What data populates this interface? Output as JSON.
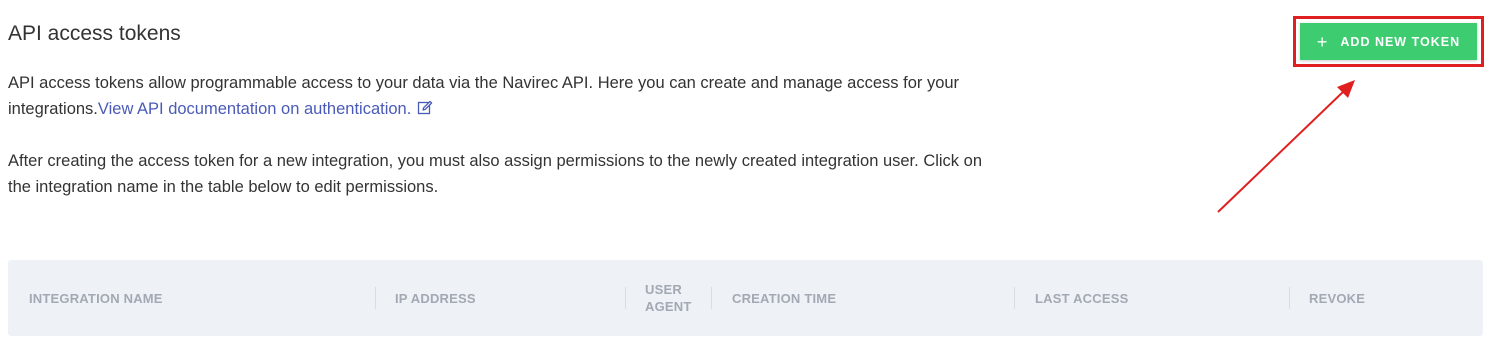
{
  "page": {
    "title": "API access tokens",
    "description_1_text": "API access tokens allow programmable access to your data via the Navirec API. Here you can create and manage access for your integrations.",
    "description_1_link": "View API documentation on authentication.",
    "description_2": "After creating the access token for a new integration, you must also assign permissions to the newly created integration user. Click on the integration name in the table below to edit permissions."
  },
  "toolbar": {
    "add_button_label": "ADD NEW TOKEN",
    "add_button_icon": "plus-icon"
  },
  "table": {
    "columns": [
      "INTEGRATION NAME",
      "IP ADDRESS",
      "USER AGENT",
      "CREATION TIME",
      "LAST ACCESS",
      "REVOKE"
    ]
  },
  "annotations": {
    "highlight_color": "#e02020",
    "arrow_color": "#e02020"
  },
  "colors": {
    "accent_green": "#3ecc71",
    "link_blue": "#4a5ab8",
    "header_bg": "#eef1f6"
  }
}
